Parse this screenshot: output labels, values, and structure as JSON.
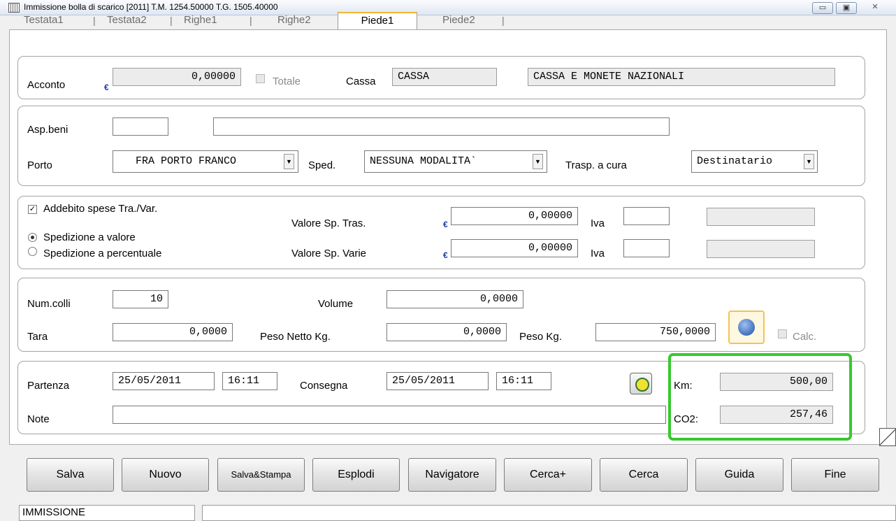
{
  "window": {
    "title": "Immissione bolla di scarico [2011] T.M.  1254.50000 T.G.  1505.40000",
    "minimize": "▭",
    "maximize": "▣",
    "close": "✕"
  },
  "tabs": [
    "Testata1",
    "Testata2",
    "Righe1",
    "Righe2",
    "Piede1",
    "Piede2"
  ],
  "active_tab": "Piede1",
  "acconto": {
    "label": "Acconto",
    "currency": "€",
    "value": "0,00000",
    "totale_label": "Totale",
    "cassa_label": "Cassa",
    "cassa_code": "CASSA",
    "cassa_desc": "CASSA E MONETE NAZIONALI"
  },
  "spedizione": {
    "asp_beni_label": "Asp.beni",
    "asp_beni_code": "",
    "asp_beni_desc": "",
    "porto_label": "Porto",
    "porto_value": "FRA  PORTO FRANCO",
    "sped_label": "Sped.",
    "sped_value": "NESSUNA MODALITA`",
    "trasp_label": "Trasp. a cura",
    "trasp_value": "Destinatario"
  },
  "spese": {
    "addebito_label": "Addebito spese Tra./Var.",
    "addebito_checked": true,
    "radio_valore": "Spedizione a valore",
    "radio_percentuale": "Spedizione a percentuale",
    "selected_radio": "valore",
    "valore_trasp_label": "Valore Sp. Tras.",
    "valore_trasp": "0,00000",
    "valore_varie_label": "Valore Sp. Varie",
    "valore_varie": "0,00000",
    "iva_label": "Iva",
    "iva_trasp": "",
    "iva_varie": "",
    "currency": "€"
  },
  "colli": {
    "num_colli_label": "Num.colli",
    "num_colli": "10",
    "volume_label": "Volume",
    "volume": "0,0000",
    "tara_label": "Tara",
    "tara": "0,0000",
    "peso_netto_label": "Peso Netto Kg.",
    "peso_netto": "0,0000",
    "peso_label": "Peso Kg.",
    "peso": "750,0000",
    "calc_label": "Calc."
  },
  "date": {
    "partenza_label": "Partenza",
    "partenza_date": "25/05/2011",
    "partenza_time": "16:11",
    "consegna_label": "Consegna",
    "consegna_date": "25/05/2011",
    "consegna_time": "16:11",
    "note_label": "Note",
    "note": "",
    "km_label": "Km:",
    "km": "500,00",
    "co2_label": "CO2:",
    "co2": "257,46"
  },
  "buttons": {
    "salva": "Salva",
    "nuovo": "Nuovo",
    "salva_stampa": "Salva&Stampa",
    "esplodi": "Esplodi",
    "navigatore": "Navigatore",
    "cerca_plus": "Cerca+",
    "cerca": "Cerca",
    "guida": "Guida",
    "fine": "Fine"
  },
  "status": {
    "mode": "IMMISSIONE",
    "message": ""
  },
  "colors": {
    "highlight": "#38c830",
    "active_tab_accent": "#f3b53a"
  }
}
